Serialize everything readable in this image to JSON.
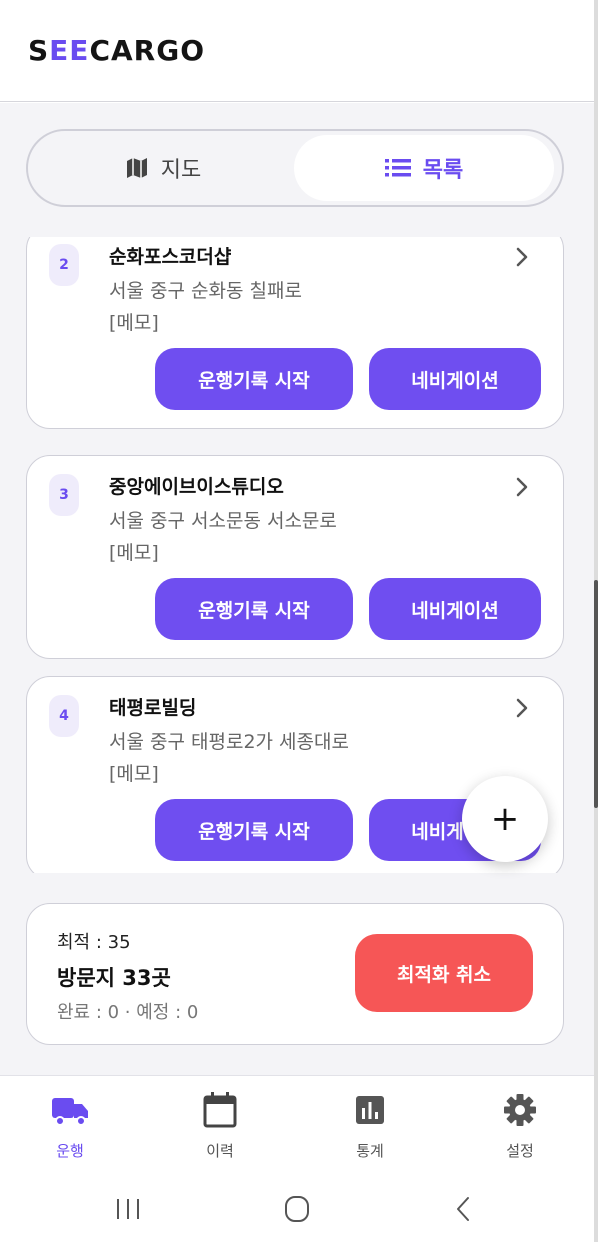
{
  "header": {
    "logo_prefix": "S",
    "logo_e": "EE",
    "logo_suffix": "CARGO"
  },
  "view_toggle": {
    "map_label": "지도",
    "list_label": "목록",
    "selected": "목록"
  },
  "stops": [
    {
      "number": "2",
      "name": "순화포스코더샵",
      "address": "서울 중구 순화동 칠패로",
      "memo": "[메모]",
      "start_label": "운행기록 시작",
      "nav_label": "네비게이션"
    },
    {
      "number": "3",
      "name": "중앙에이브이스튜디오",
      "address": "서울 중구 서소문동 서소문로",
      "memo": "[메모]",
      "start_label": "운행기록 시작",
      "nav_label": "네비게이션"
    },
    {
      "number": "4",
      "name": "태평로빌딩",
      "address": "서울 중구 태평로2가 세종대로",
      "memo": "[메모]",
      "start_label": "운행기록 시작",
      "nav_label": "네비게이션"
    }
  ],
  "fab": {
    "symbol": "+"
  },
  "summary": {
    "optimal": "최적 : 35",
    "visits": "방문지 33곳",
    "status": "완료 : 0 · 예정 : 0",
    "cancel_label": "최적화 취소"
  },
  "bottom_nav": {
    "items": [
      {
        "label": "운행",
        "icon": "truck-icon",
        "active": true
      },
      {
        "label": "이력",
        "icon": "calendar-icon",
        "active": false
      },
      {
        "label": "통계",
        "icon": "chart-icon",
        "active": false
      },
      {
        "label": "설정",
        "icon": "gear-icon",
        "active": false
      }
    ]
  },
  "colors": {
    "accent": "#6f4ef0",
    "danger": "#f65656",
    "background": "#f4f4f7"
  }
}
